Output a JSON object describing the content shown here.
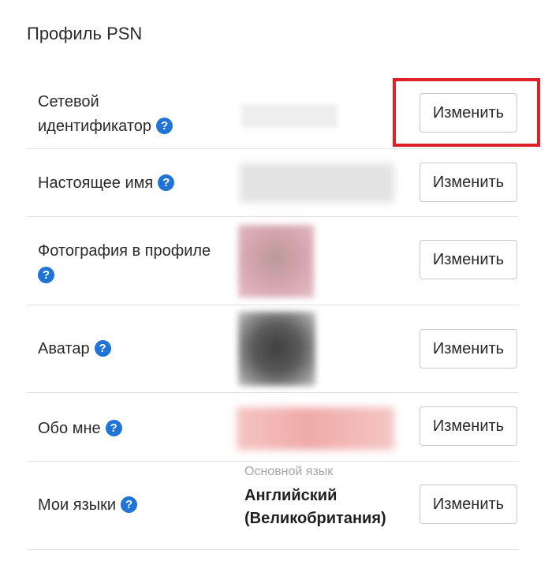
{
  "page_title": "Профиль PSN",
  "help_glyph": "?",
  "edit_label": "Изменить",
  "rows": {
    "online_id": {
      "label_line1": "Сетевой",
      "label_line2": "идентификатор"
    },
    "real_name": {
      "label": "Настоящее имя"
    },
    "profile_photo": {
      "label": "Фотография в профиле"
    },
    "avatar": {
      "label": "Аватар"
    },
    "about_me": {
      "label": "Обо мне"
    },
    "languages": {
      "label": "Мои языки",
      "caption": "Основной язык",
      "value_line1": "Английский",
      "value_line2": "(Великобритания)"
    }
  },
  "colors": {
    "accent_blue": "#1f74d6",
    "highlight_red": "#e01f2b",
    "divider": "#e2e2e2"
  },
  "icons": {
    "help": "question-circle-icon"
  }
}
